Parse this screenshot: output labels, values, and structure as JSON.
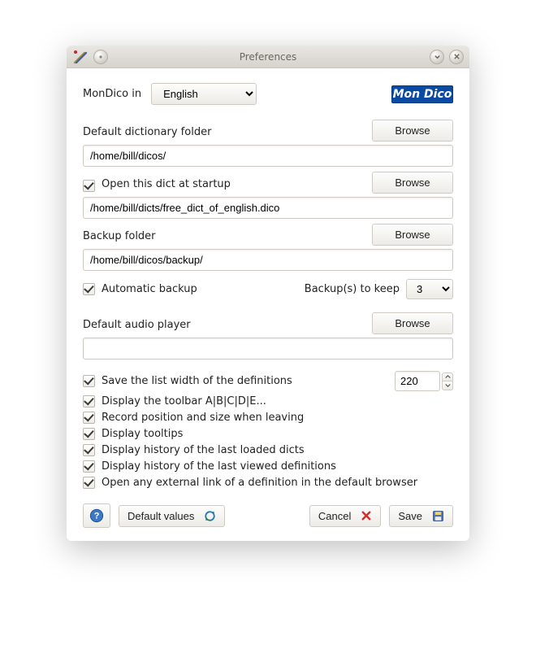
{
  "window": {
    "title": "Preferences"
  },
  "lang_row": {
    "label": "MonDico in",
    "value": "English"
  },
  "logo_text": "Mon Dico",
  "dict_folder": {
    "label": "Default dictionary folder",
    "value": "/home/bill/dicos/",
    "browse": "Browse"
  },
  "startup": {
    "label": "Open this dict at startup",
    "checked": true,
    "value": "/home/bill/dicts/free_dict_of_english.dico",
    "browse": "Browse"
  },
  "backup_folder": {
    "label": "Backup folder",
    "value": "/home/bill/dicos/backup/",
    "browse": "Browse"
  },
  "auto_backup": {
    "label": "Automatic backup",
    "checked": true
  },
  "backups_keep": {
    "label": "Backup(s) to keep",
    "value": "3"
  },
  "audio": {
    "label": "Default audio player",
    "value": "",
    "browse": "Browse"
  },
  "list_width": {
    "label": "Save the list width of the definitions",
    "checked": true,
    "value": "220"
  },
  "checks": [
    {
      "label": "Display the toolbar A|B|C|D|E...",
      "checked": true
    },
    {
      "label": "Record position and size when leaving",
      "checked": true
    },
    {
      "label": "Display tooltips",
      "checked": true
    },
    {
      "label": "Display history of the last loaded dicts",
      "checked": true
    },
    {
      "label": "Display history of the last viewed definitions",
      "checked": true
    },
    {
      "label": "Open any external link of a definition in the default browser",
      "checked": true
    }
  ],
  "buttons": {
    "help": "Help",
    "defaults": "Default values",
    "cancel": "Cancel",
    "save": "Save"
  }
}
